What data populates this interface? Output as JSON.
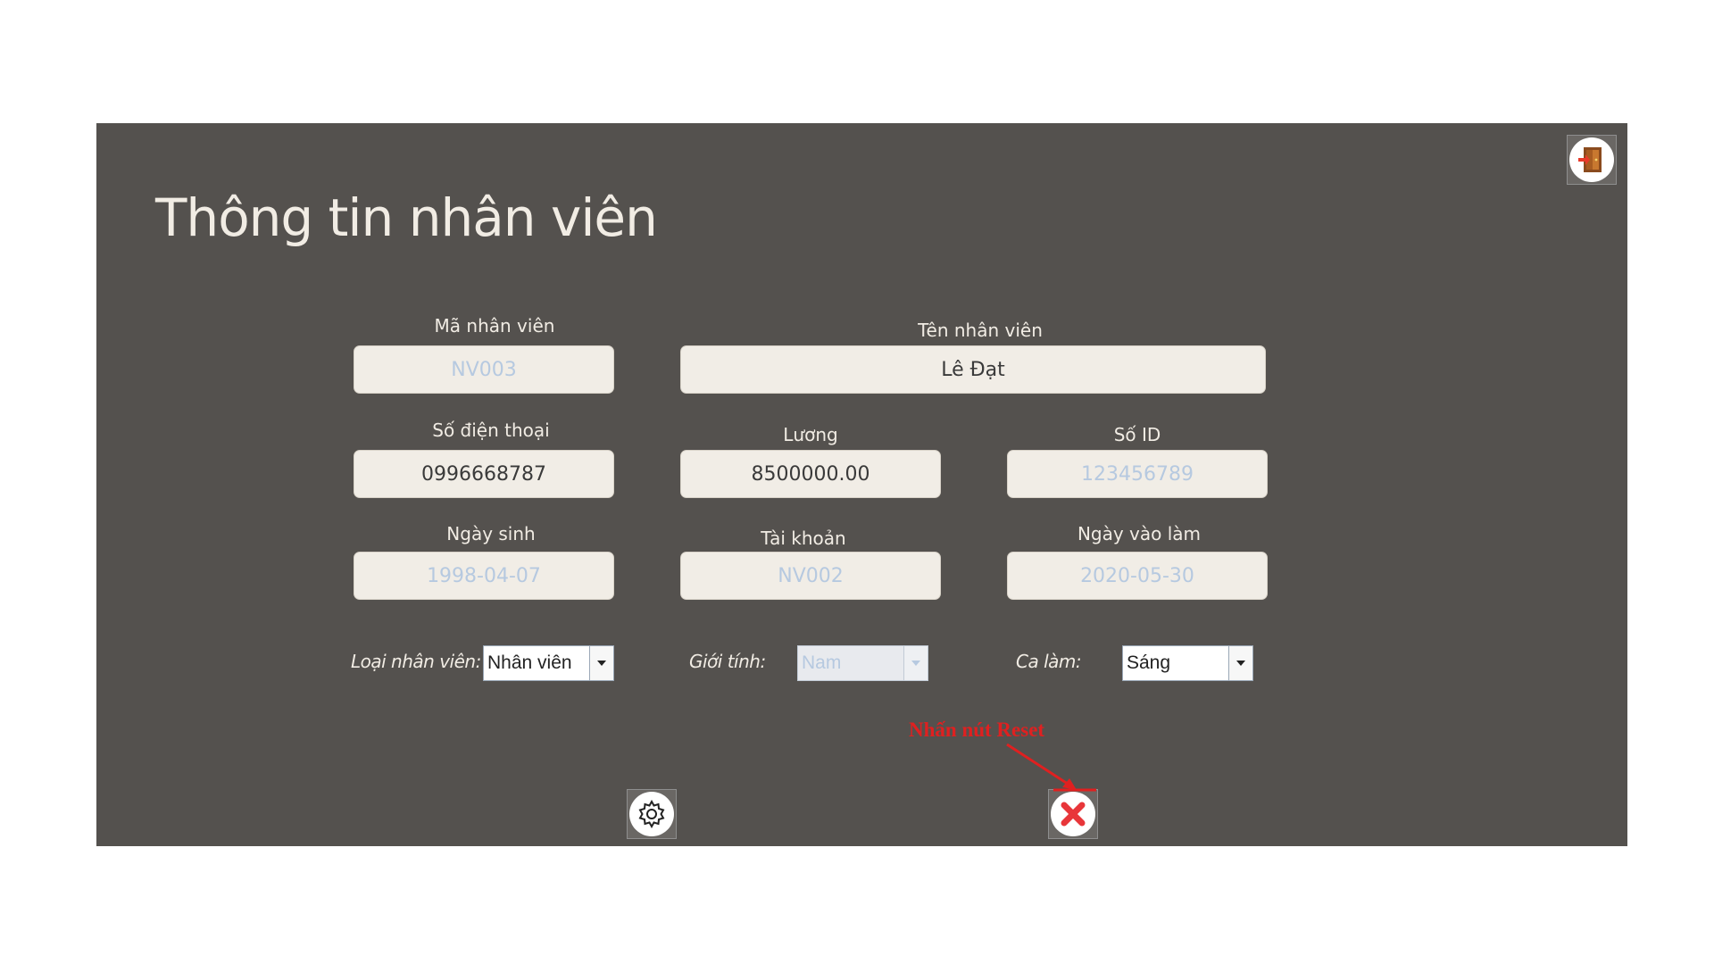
{
  "page_title": "Thông tin nhân viên",
  "fields": {
    "ma_nv": {
      "label": "Mã nhân viên",
      "value": "NV003"
    },
    "ten_nv": {
      "label": "Tên nhân viên",
      "value": "Lê Đạt"
    },
    "sdt": {
      "label": "Số điện thoại",
      "value": "0996668787"
    },
    "luong": {
      "label": "Lương",
      "value": "8500000.00"
    },
    "so_id": {
      "label": "Số ID",
      "value": "123456789"
    },
    "ngay_sinh": {
      "label": "Ngày sinh",
      "value": "1998-04-07"
    },
    "tai_khoan": {
      "label": "Tài khoản",
      "value": "NV002"
    },
    "ngay_vao": {
      "label": "Ngày vào làm",
      "value": "2020-05-30"
    }
  },
  "combos": {
    "loai_nv": {
      "label": "Loại nhân viên:",
      "value": "Nhân viên"
    },
    "gioi_tinh": {
      "label": "Giới tính:",
      "value": "Nam"
    },
    "ca_lam": {
      "label": "Ca làm:",
      "value": "Sáng"
    }
  },
  "annotation": "Nhấn nút Reset",
  "icons": {
    "exit": "exit-door-icon",
    "settings": "gear-icon",
    "reset": "red-x-icon"
  },
  "colors": {
    "panel_bg": "#54514e",
    "field_bg": "#f1ede6",
    "readonly_text": "#b6c9e0",
    "annotation": "#e02020"
  }
}
